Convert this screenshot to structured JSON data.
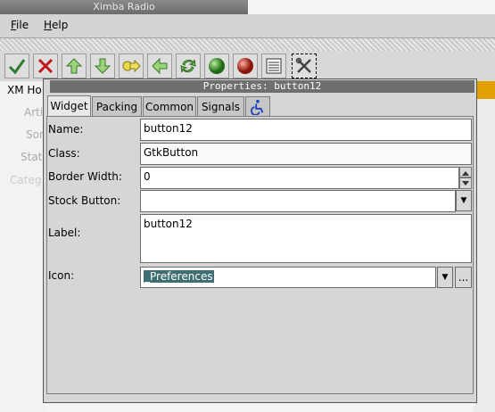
{
  "main_window": {
    "title": "Ximba Radio",
    "menu": [
      {
        "label": "File",
        "mnemonic": "F",
        "rest": "ile"
      },
      {
        "label": "Help",
        "mnemonic": "H",
        "rest": "elp"
      }
    ],
    "toolbar_icons": [
      "check-icon",
      "delete-icon",
      "up-arrow-icon",
      "down-arrow-icon",
      "forward-icon",
      "back-icon",
      "refresh-icon",
      "green-ball-icon",
      "red-ball-icon",
      "list-icon",
      "tools-icon"
    ],
    "sidebar": {
      "header": "XM Ho",
      "items": [
        "Arti",
        "Son",
        "Stat",
        "Categ"
      ]
    }
  },
  "dialog": {
    "title": "Properties: button12",
    "tabs": [
      "Widget",
      "Packing",
      "Common",
      "Signals"
    ],
    "active_tab": "Widget",
    "fields": {
      "name": {
        "label": "Name:",
        "value": "button12"
      },
      "class": {
        "label": "Class:",
        "value": "GtkButton"
      },
      "border_width": {
        "label": "Border Width:",
        "value": "0"
      },
      "stock_button": {
        "label": "Stock Button:",
        "value": ""
      },
      "label": {
        "label": "Label:",
        "value": "button12"
      },
      "icon": {
        "label": "Icon:",
        "value": "_Preferences",
        "browse_label": "..."
      }
    }
  },
  "colors": {
    "accent_selection": "#3f6f72",
    "dialog_title_bg": "#6f6f6f",
    "right_strip": "#e0a000"
  }
}
